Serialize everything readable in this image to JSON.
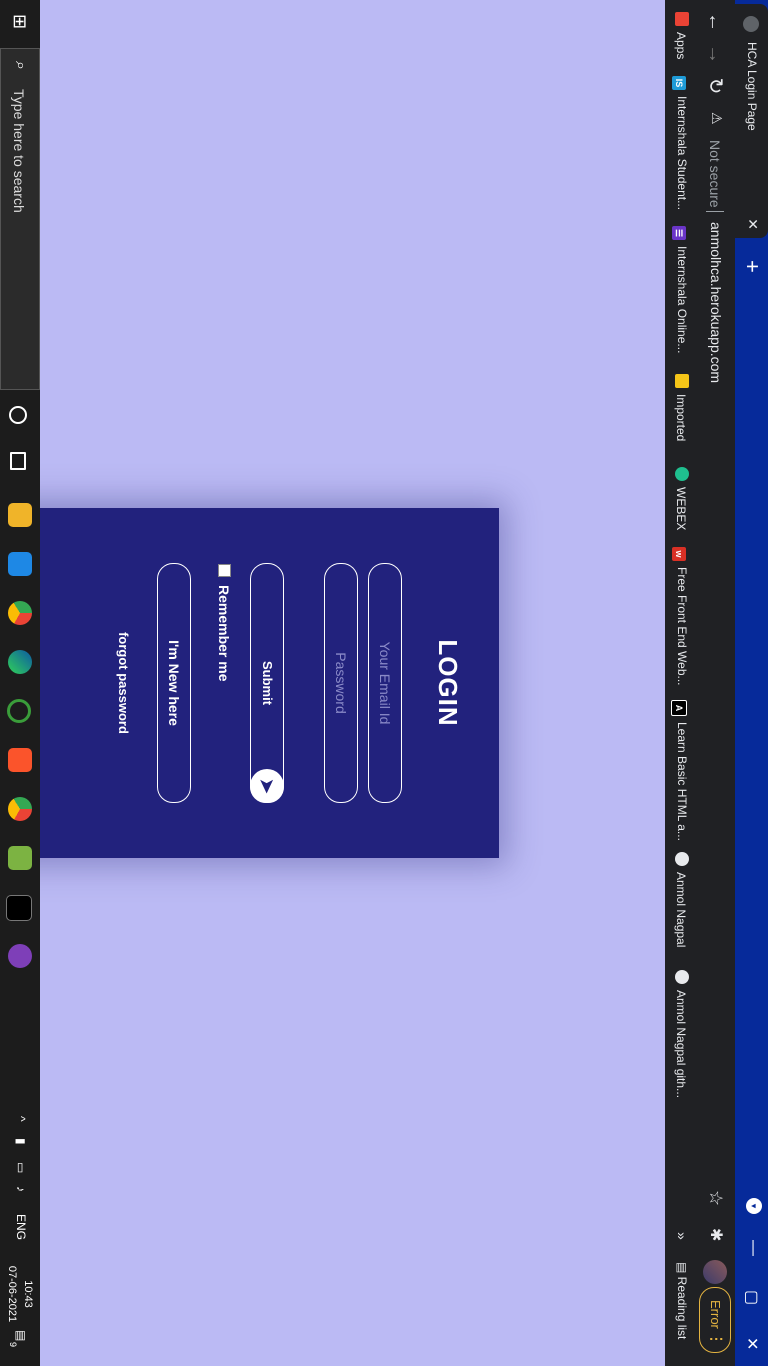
{
  "browser": {
    "tab_title": "HCA Login Page",
    "tab_close": "✕",
    "new_tab": "+",
    "not_secure": "Not secure",
    "url": "anmolhca.herokuapp.com",
    "error_label": "Error",
    "reading_list": "Reading list",
    "window_controls": [
      "—",
      "▢",
      "✕"
    ]
  },
  "bookmarks": [
    {
      "label": "Apps",
      "icon": "apps-grid-icon",
      "color": "#ea4335"
    },
    {
      "label": "Internshala Student...",
      "icon": "internshala-icon",
      "color": "#1e9bd7",
      "glyph": "IS"
    },
    {
      "label": "Internshala Online...",
      "icon": "internshala-trainings-icon",
      "color": "#6a35c8",
      "glyph": "☰"
    },
    {
      "label": "Imported",
      "icon": "folder-icon",
      "color": "#f5c518"
    },
    {
      "label": "WEBEX",
      "icon": "webex-icon",
      "color": "#1fbf8f"
    },
    {
      "label": "Free Front End Web...",
      "icon": "frontend-course-icon",
      "color": "#d93025"
    },
    {
      "label": "Learn Basic HTML a...",
      "icon": "learn-html-icon",
      "color": "#000000"
    },
    {
      "label": "Anmol Nagpal",
      "icon": "globe-icon",
      "color": "#e8eaed"
    },
    {
      "label": "Anmol Nagpal gith...",
      "icon": "globe-icon",
      "color": "#e8eaed"
    }
  ],
  "login": {
    "title": "LOGIN",
    "email_placeholder": "Your Email Id",
    "password_placeholder": "Password",
    "submit_label": "Submit",
    "remember_label": "Remember me",
    "new_here_label": "I'm New here",
    "forgot_label": "forgot password"
  },
  "taskbar": {
    "search_placeholder": "Type here to search",
    "language": "ENG",
    "time": "10:43",
    "date": "07-06-2021",
    "notification_count": "9"
  },
  "colors": {
    "page_bg": "#bbbaf4",
    "card_bg": "#22227d",
    "tab_strip": "#062a9a"
  }
}
